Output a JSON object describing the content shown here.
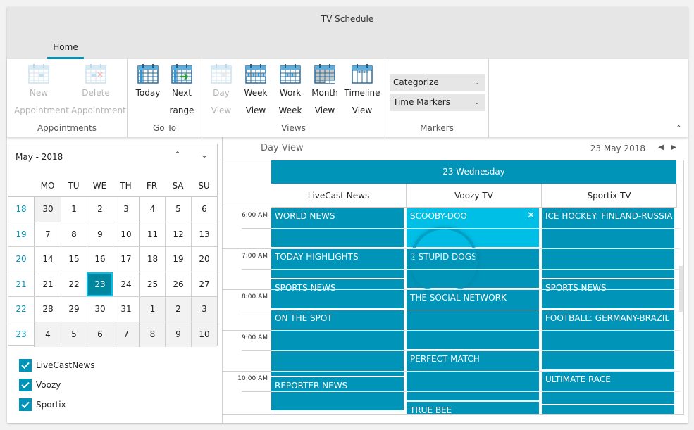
{
  "window": {
    "title": "TV Schedule"
  },
  "tabs": [
    {
      "label": "Home",
      "active": true
    }
  ],
  "ribbon": {
    "groups": [
      {
        "label": "Appointments",
        "buttons": [
          {
            "line1": "New",
            "line2": "Appointment",
            "icon": "calendar-new-icon",
            "enabled": false
          },
          {
            "line1": "Delete",
            "line2": "Appointment",
            "icon": "calendar-delete-icon",
            "enabled": false
          }
        ]
      },
      {
        "label": "Go To",
        "buttons": [
          {
            "line1": "Today",
            "line2": "",
            "icon": "calendar-today-icon",
            "enabled": true
          },
          {
            "line1": "Next",
            "line2": "range",
            "icon": "calendar-next-icon",
            "enabled": true
          }
        ]
      },
      {
        "label": "Views",
        "buttons": [
          {
            "line1": "Day",
            "line2": "View",
            "icon": "calendar-day-icon",
            "enabled": false
          },
          {
            "line1": "Week",
            "line2": "View",
            "icon": "calendar-week-icon",
            "enabled": true
          },
          {
            "line1": "Work",
            "line2": "Week",
            "icon": "calendar-workweek-icon",
            "enabled": true
          },
          {
            "line1": "Month",
            "line2": "View",
            "icon": "calendar-month-icon",
            "enabled": true
          },
          {
            "line1": "Timeline",
            "line2": "View",
            "icon": "calendar-timeline-icon",
            "enabled": true
          }
        ]
      },
      {
        "label": "Markers",
        "combos": [
          {
            "value": "Categorize"
          },
          {
            "value": "Time Markers"
          }
        ]
      }
    ]
  },
  "calendar": {
    "header": "May - 2018",
    "days_of_week": [
      "MO",
      "TU",
      "WE",
      "TH",
      "FR",
      "SA",
      "SU"
    ],
    "weeks": [
      {
        "week": "18",
        "days": [
          "30",
          "1",
          "2",
          "3",
          "4",
          "5",
          "6"
        ],
        "other": [
          0
        ]
      },
      {
        "week": "19",
        "days": [
          "7",
          "8",
          "9",
          "10",
          "11",
          "12",
          "13"
        ],
        "other": []
      },
      {
        "week": "20",
        "days": [
          "14",
          "15",
          "16",
          "17",
          "18",
          "19",
          "20"
        ],
        "other": []
      },
      {
        "week": "21",
        "days": [
          "21",
          "22",
          "23",
          "24",
          "25",
          "26",
          "27"
        ],
        "other": []
      },
      {
        "week": "22",
        "days": [
          "28",
          "29",
          "30",
          "31",
          "1",
          "2",
          "3"
        ],
        "other": [
          4,
          5,
          6
        ]
      },
      {
        "week": "23",
        "days": [
          "4",
          "5",
          "6",
          "7",
          "8",
          "9",
          "10"
        ],
        "other": [
          0,
          1,
          2,
          3,
          4,
          5,
          6
        ]
      }
    ],
    "selected": {
      "week_index": 3,
      "day_index": 2
    }
  },
  "filters": [
    {
      "label": "LiveCastNews",
      "checked": true
    },
    {
      "label": "Voozy",
      "checked": true
    },
    {
      "label": "Sportix",
      "checked": true
    }
  ],
  "schedule": {
    "view_title": "Day View",
    "current_date": "23 May 2018",
    "day_header": "23 Wednesday",
    "resources": [
      "LiveCast News",
      "Voozy TV",
      "Sportix TV"
    ],
    "time_labels": [
      "6:00 AM",
      "7:00 AM",
      "8:00 AM",
      "9:00 AM",
      "10:00 AM"
    ],
    "appointments": [
      {
        "resource": 0,
        "title": "WORLD NEWS",
        "start": 6.0,
        "end": 7.0
      },
      {
        "resource": 0,
        "title": "TODAY HIGHLIGHTS",
        "start": 7.0,
        "end": 7.75
      },
      {
        "resource": 0,
        "title": "SPORTS NEWS",
        "start": 7.75,
        "end": 8.5
      },
      {
        "resource": 0,
        "title": "ON THE SPOT",
        "start": 8.5,
        "end": 10.15
      },
      {
        "resource": 0,
        "title": "REPORTER NEWS",
        "start": 10.15,
        "end": 11.0
      },
      {
        "resource": 1,
        "title": "SCOOBY-DOO",
        "start": 6.0,
        "end": 7.0,
        "selected": true
      },
      {
        "resource": 1,
        "title": "2 STUPID DOGS",
        "start": 7.0,
        "end": 8.0
      },
      {
        "resource": 1,
        "title": "THE SOCIAL NETWORK",
        "start": 8.0,
        "end": 9.5
      },
      {
        "resource": 1,
        "title": "PERFECT MATCH",
        "start": 9.5,
        "end": 10.75
      },
      {
        "resource": 1,
        "title": "TRUE BEE",
        "start": 10.75,
        "end": 11.5
      },
      {
        "resource": 2,
        "title": "ICE HOCKEY: FINLAND-RUSSIA",
        "start": 6.0,
        "end": 7.75
      },
      {
        "resource": 2,
        "title": "SPORTS NEWS",
        "start": 7.75,
        "end": 8.5
      },
      {
        "resource": 2,
        "title": "FOOTBALL: GERMANY-BRAZIL",
        "start": 8.5,
        "end": 10.0
      },
      {
        "resource": 2,
        "title": "ULTIMATE RACE",
        "start": 10.0,
        "end": 10.85
      },
      {
        "resource": 2,
        "title": "",
        "start": 10.85,
        "end": 11.5
      }
    ],
    "delete_glyph": "✕"
  },
  "colors": {
    "accent": "#0094b8",
    "selected_appt": "#00bfe7",
    "week_number": "#0094b8"
  }
}
